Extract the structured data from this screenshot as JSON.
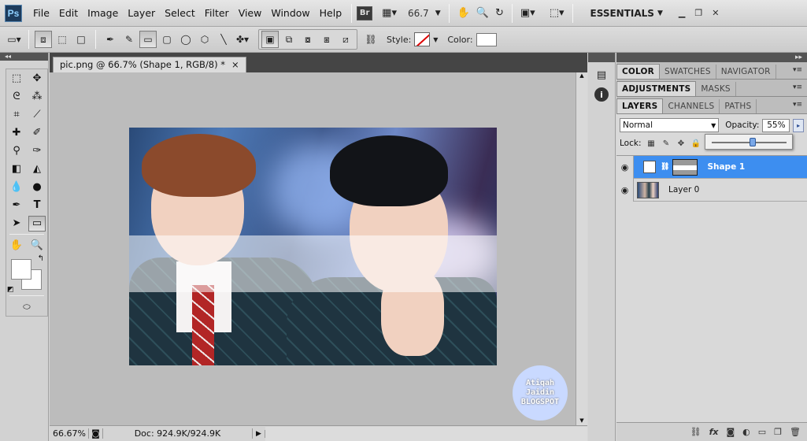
{
  "menubar": {
    "logo": "Ps",
    "items": [
      "File",
      "Edit",
      "Image",
      "Layer",
      "Select",
      "Filter",
      "View",
      "Window",
      "Help"
    ],
    "bridge_label": "Br",
    "zoom": "66.7",
    "workspace": "ESSENTIALS",
    "win_min": "▁",
    "win_restore": "❐",
    "win_close": "✕"
  },
  "options": {
    "style_label": "Style:",
    "color_label": "Color:"
  },
  "document": {
    "tab_title": "pic.png @ 66.7% (Shape 1, RGB/8) *",
    "tab_close": "×",
    "status_zoom": "66.67%",
    "status_doc": "Doc: 924.9K/924.9K"
  },
  "watermark": {
    "line1": "Atiqah",
    "line2": "Jaidin",
    "line3": "BLOGSPOT"
  },
  "panels": {
    "group1_tabs": [
      "COLOR",
      "SWATCHES",
      "NAVIGATOR"
    ],
    "group2_tabs": [
      "ADJUSTMENTS",
      "MASKS"
    ],
    "group3_tabs": [
      "LAYERS",
      "CHANNELS",
      "PATHS"
    ],
    "blend_mode": "Normal",
    "opacity_label": "Opacity:",
    "opacity_value": "55%",
    "opacity_level": 0.55,
    "lock_label": "Lock:",
    "layers": [
      {
        "name": "Shape 1",
        "selected": true
      },
      {
        "name": "Layer 0",
        "selected": false
      }
    ]
  },
  "colors": {
    "selection": "#3d8ef0",
    "foreground": "#ffffff",
    "background": "#ffffff"
  }
}
